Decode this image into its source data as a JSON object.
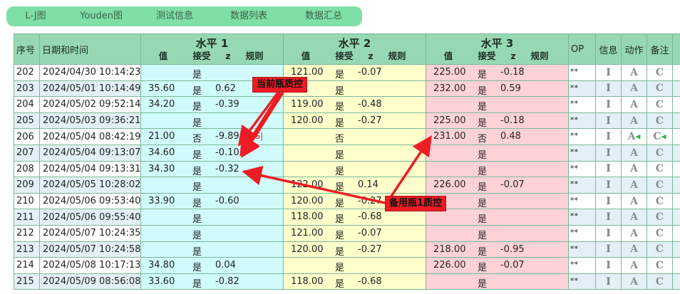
{
  "tabs": [
    "L-J图",
    "Youden图",
    "测试信息",
    "数据列表",
    "数据汇总"
  ],
  "headers": {
    "seq": "序号",
    "datetime": "日期和时间",
    "levels": [
      {
        "title": "水平 1",
        "value": "值",
        "accept": "接受",
        "z": "z",
        "rule": "规则"
      },
      {
        "title": "水平 2",
        "value": "值",
        "accept": "接受",
        "z": "z",
        "rule": "规则"
      },
      {
        "title": "水平 3",
        "value": "值",
        "accept": "接受",
        "z": "z",
        "rule": "规则"
      }
    ],
    "op": "OP",
    "info": "信息",
    "action": "动作",
    "remark": "备注"
  },
  "icons": {
    "info": "I",
    "action": "A",
    "remark": "C"
  },
  "rows": [
    {
      "seq": "202",
      "dt": "2024/04/30 10:14:23",
      "l1": {
        "v": "",
        "a": "是",
        "z": "",
        "r": ""
      },
      "l2": {
        "v": "121.00",
        "a": "是",
        "z": "-0.07",
        "r": ""
      },
      "l3": {
        "v": "225.00",
        "a": "是",
        "z": "-0.18",
        "r": ""
      },
      "op": "**"
    },
    {
      "seq": "203",
      "dt": "2024/05/01 10:14:49",
      "l1": {
        "v": "35.60",
        "a": "是",
        "z": "0.62",
        "r": ""
      },
      "l2": {
        "v": "",
        "a": "是",
        "z": "",
        "r": ""
      },
      "l3": {
        "v": "232.00",
        "a": "是",
        "z": "0.59",
        "r": ""
      },
      "op": "**"
    },
    {
      "seq": "204",
      "dt": "2024/05/02 09:52:14",
      "l1": {
        "v": "34.20",
        "a": "是",
        "z": "-0.39",
        "r": ""
      },
      "l2": {
        "v": "119.00",
        "a": "是",
        "z": "-0.48",
        "r": ""
      },
      "l3": {
        "v": "",
        "a": "是",
        "z": "",
        "r": ""
      },
      "op": "**"
    },
    {
      "seq": "205",
      "dt": "2024/05/03 09:36:21",
      "l1": {
        "v": "",
        "a": "是",
        "z": "",
        "r": ""
      },
      "l2": {
        "v": "120.00",
        "a": "是",
        "z": "-0.27",
        "r": ""
      },
      "l3": {
        "v": "225.00",
        "a": "是",
        "z": "-0.18",
        "r": ""
      },
      "op": "**"
    },
    {
      "seq": "206",
      "dt": "2024/05/04 08:42:19",
      "l1": {
        "v": "21.00",
        "a": "否",
        "z": "-9.89",
        "r": "1-3S|"
      },
      "l2": {
        "v": "",
        "a": "否",
        "z": "",
        "r": ""
      },
      "l3": {
        "v": "231.00",
        "a": "否",
        "z": "0.48",
        "r": ""
      },
      "op": "**",
      "flag": true
    },
    {
      "seq": "207",
      "dt": "2024/05/04 09:13:07",
      "l1": {
        "v": "34.60",
        "a": "是",
        "z": "-0.10",
        "r": ""
      },
      "l2": {
        "v": "",
        "a": "是",
        "z": "",
        "r": ""
      },
      "l3": {
        "v": "",
        "a": "是",
        "z": "",
        "r": ""
      },
      "op": "**"
    },
    {
      "seq": "208",
      "dt": "2024/05/04 09:13:31",
      "l1": {
        "v": "34.30",
        "a": "是",
        "z": "-0.32",
        "r": ""
      },
      "l2": {
        "v": "",
        "a": "是",
        "z": "",
        "r": ""
      },
      "l3": {
        "v": "",
        "a": "是",
        "z": "",
        "r": ""
      },
      "op": "**"
    },
    {
      "seq": "209",
      "dt": "2024/05/05 10:28:02",
      "l1": {
        "v": "",
        "a": "是",
        "z": "",
        "r": ""
      },
      "l2": {
        "v": "122.00",
        "a": "是",
        "z": "0.14",
        "r": ""
      },
      "l3": {
        "v": "226.00",
        "a": "是",
        "z": "-0.07",
        "r": ""
      },
      "op": "**"
    },
    {
      "seq": "210",
      "dt": "2024/05/06 09:53:40",
      "l1": {
        "v": "33.90",
        "a": "是",
        "z": "-0.60",
        "r": ""
      },
      "l2": {
        "v": "120.00",
        "a": "是",
        "z": "-0.27",
        "r": ""
      },
      "l3": {
        "v": "",
        "a": "是",
        "z": "",
        "r": ""
      },
      "op": "**"
    },
    {
      "seq": "211",
      "dt": "2024/05/06 09:55:40",
      "l1": {
        "v": "",
        "a": "是",
        "z": "",
        "r": ""
      },
      "l2": {
        "v": "118.00",
        "a": "是",
        "z": "-0.68",
        "r": ""
      },
      "l3": {
        "v": "",
        "a": "是",
        "z": "",
        "r": ""
      },
      "op": "**"
    },
    {
      "seq": "212",
      "dt": "2024/05/07 10:24:35",
      "l1": {
        "v": "",
        "a": "是",
        "z": "",
        "r": ""
      },
      "l2": {
        "v": "121.00",
        "a": "是",
        "z": "-0.07",
        "r": ""
      },
      "l3": {
        "v": "",
        "a": "是",
        "z": "",
        "r": ""
      },
      "op": "**"
    },
    {
      "seq": "213",
      "dt": "2024/05/07 10:24:58",
      "l1": {
        "v": "",
        "a": "是",
        "z": "",
        "r": ""
      },
      "l2": {
        "v": "120.00",
        "a": "是",
        "z": "-0.27",
        "r": ""
      },
      "l3": {
        "v": "218.00",
        "a": "是",
        "z": "-0.95",
        "r": ""
      },
      "op": "**"
    },
    {
      "seq": "214",
      "dt": "2024/05/08 10:17:13",
      "l1": {
        "v": "34.80",
        "a": "是",
        "z": "0.04",
        "r": ""
      },
      "l2": {
        "v": "",
        "a": "是",
        "z": "",
        "r": ""
      },
      "l3": {
        "v": "226.00",
        "a": "是",
        "z": "-0.07",
        "r": ""
      },
      "op": "**"
    },
    {
      "seq": "215",
      "dt": "2024/05/09 08:56:08",
      "l1": {
        "v": "33.60",
        "a": "是",
        "z": "-0.82",
        "r": ""
      },
      "l2": {
        "v": "118.00",
        "a": "是",
        "z": "-0.68",
        "r": ""
      },
      "l3": {
        "v": "",
        "a": "是",
        "z": "",
        "r": ""
      },
      "op": "**"
    }
  ],
  "annotations": {
    "current_control": "当前瓶质控",
    "backup_control": "备用瓶1质控"
  },
  "colors": {
    "tab_bg": "#7fe0a7",
    "header_bg": "#97d8b4",
    "level1_bg": "#d0fbfb",
    "level2_bg": "#ffffcc",
    "level3_bg": "#ffd2d7",
    "annotation": "#ee1c24"
  }
}
